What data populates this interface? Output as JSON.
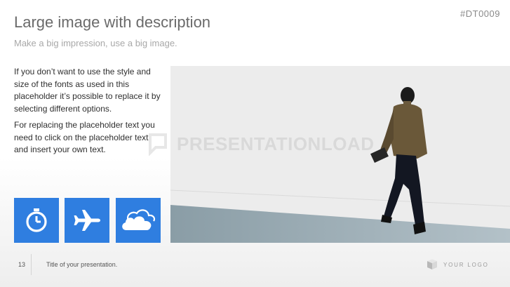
{
  "slide": {
    "code": "#DT0009",
    "title": "Large image with description",
    "subtitle": "Make a big impression, use a big image.",
    "paragraphs": [
      "If you don’t want to use the style and size of the fonts as used in this placeholder it’s possible to replace it by selecting different options.",
      "For replacing the placeholder text you need to click on the placeholder text and insert your own text."
    ],
    "icons": [
      "stopwatch-icon",
      "airplane-icon",
      "cloud-icon"
    ],
    "watermark": "PRESENTATIONLOAD"
  },
  "footer": {
    "page_number": "13",
    "presentation_title": "Title of your presentation.",
    "logo_text": "YOUR LOGO"
  },
  "colors": {
    "accent": "#2f7ee0",
    "title": "#6a6a6a",
    "subtitle": "#a8a8a8",
    "body": "#2f2f2f"
  }
}
